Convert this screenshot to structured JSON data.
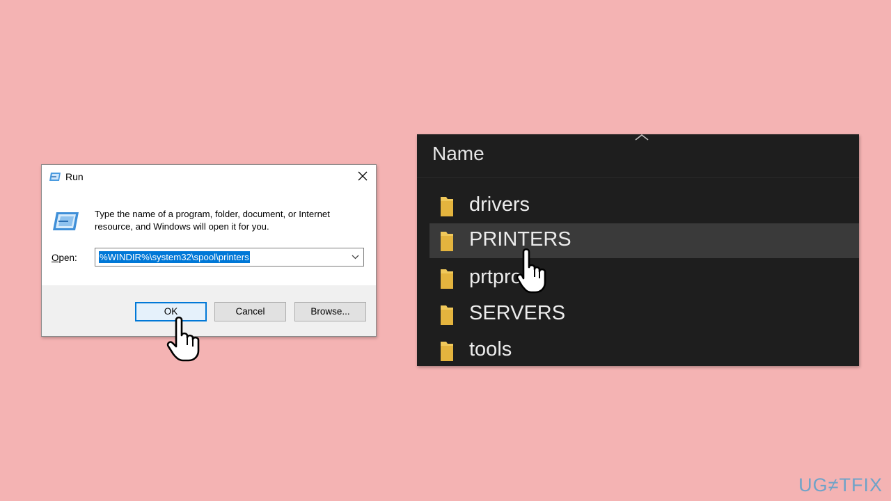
{
  "run_dialog": {
    "title": "Run",
    "close_icon": "close-icon",
    "description": "Type the name of a program, folder, document, or Internet resource, and Windows will open it for you.",
    "open_label_hotkey": "O",
    "open_label_rest": "pen:",
    "open_value": "%WINDIR%\\system32\\spool\\printers",
    "ok_label": "OK",
    "cancel_label": "Cancel",
    "browse_label": "Browse..."
  },
  "explorer": {
    "column_header": "Name",
    "items": [
      {
        "label": "drivers",
        "selected": false
      },
      {
        "label": "PRINTERS",
        "selected": true
      },
      {
        "label": "prtprocs",
        "selected": false
      },
      {
        "label": "SERVERS",
        "selected": false
      },
      {
        "label": "tools",
        "selected": false
      }
    ]
  },
  "watermark": "UG≠TFIX",
  "colors": {
    "background": "#f4b3b3",
    "accent": "#0078d7",
    "explorer_bg": "#1e1e1e",
    "folder": "#f0c85a"
  }
}
